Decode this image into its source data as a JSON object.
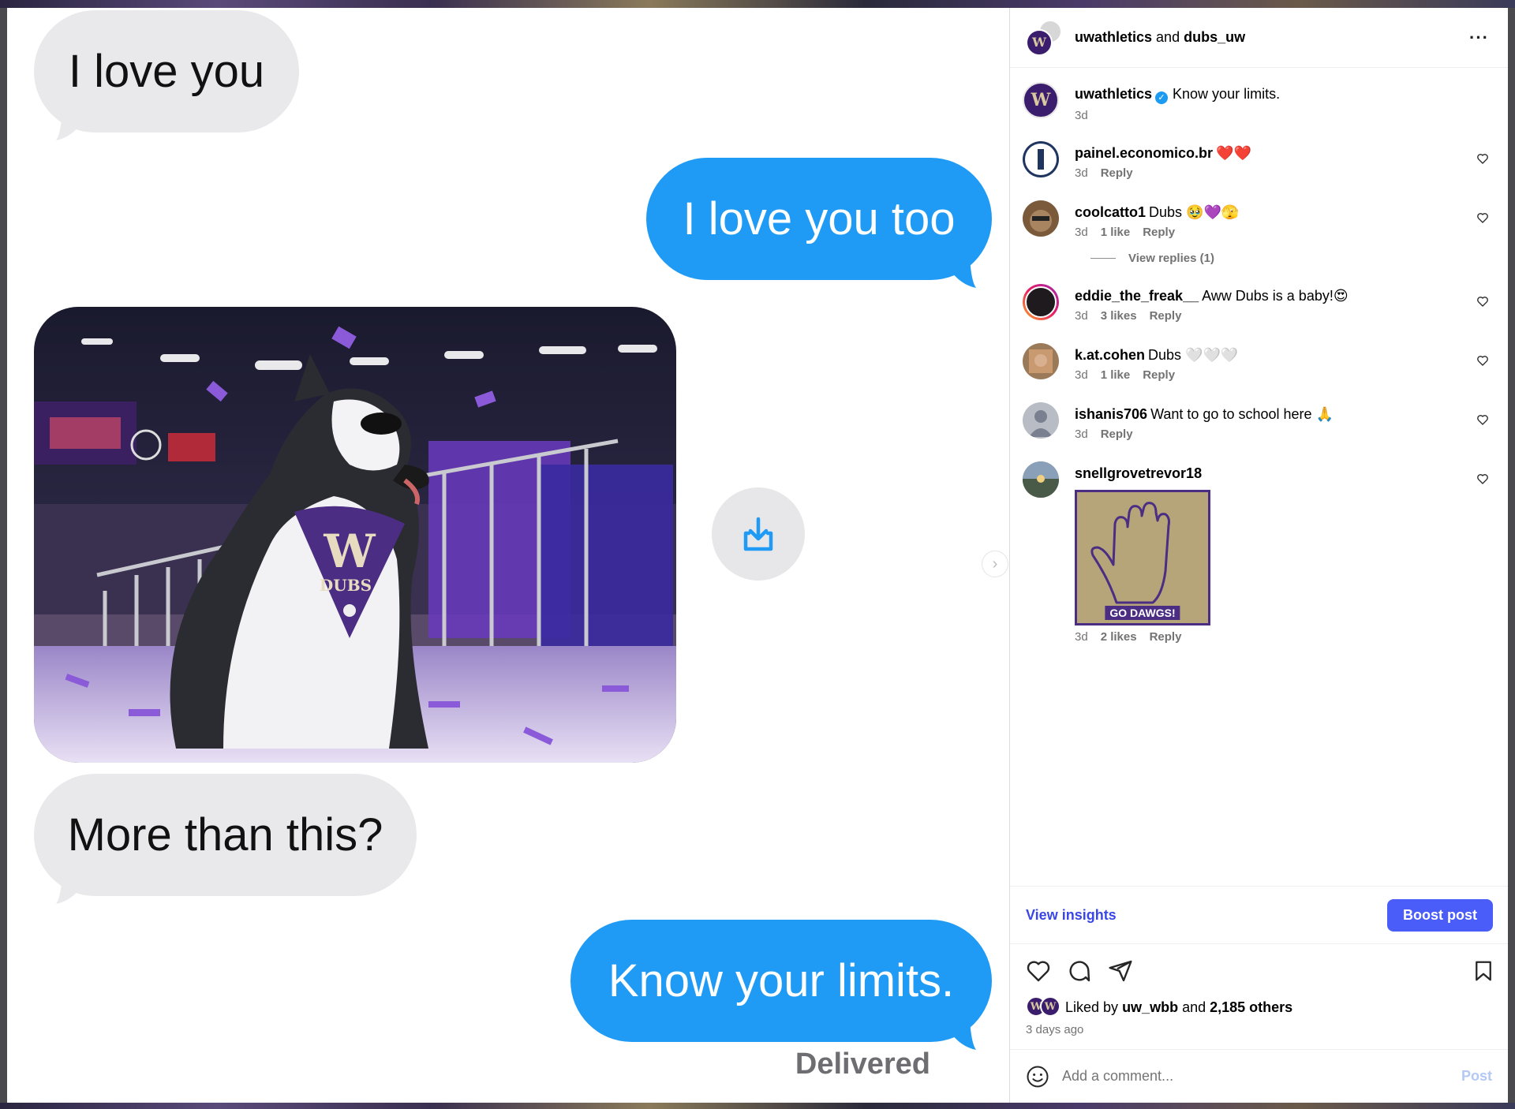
{
  "media": {
    "bubble_1": "I love you",
    "bubble_2": "I love you too",
    "bubble_3": "More than this?",
    "bubble_4": "Know your limits.",
    "status": "Delivered",
    "photo_bandana": "DUBS"
  },
  "header": {
    "user_a": "uwathletics",
    "joiner": "and",
    "user_b": "dubs_uw",
    "more_icon": "more-horizontal-icon"
  },
  "caption": {
    "user": "uwathletics",
    "text": "Know your limits.",
    "time": "3d"
  },
  "comments": [
    {
      "user": "painel.economico.br",
      "text": "❤️❤️",
      "time": "3d",
      "likes": "",
      "reply": "Reply",
      "avatar_color": "#2a3b5c"
    },
    {
      "user": "coolcatto1",
      "text": "Dubs 🥹💜🫣",
      "time": "3d",
      "likes": "1 like",
      "reply": "Reply",
      "avatar_color": "#7a5a3a"
    },
    {
      "user": "eddie_the_freak__",
      "text": "Aww Dubs is a baby!😍",
      "time": "3d",
      "likes": "3 likes",
      "reply": "Reply",
      "avatar_color": "#1e1a1e"
    },
    {
      "user": "k.at.cohen",
      "text": "Dubs 🤍🤍🤍",
      "time": "3d",
      "likes": "1 like",
      "reply": "Reply",
      "avatar_color": "#9b7a5a"
    },
    {
      "user": "ishanis706",
      "text": "Want to go to school here 🙏",
      "time": "3d",
      "likes": "",
      "reply": "Reply",
      "avatar_color": "#b8bcc4"
    },
    {
      "user": "snellgrovetrevor18",
      "text": "",
      "time": "3d",
      "likes": "2 likes",
      "reply": "Reply",
      "avatar_color": "#6b7a6a"
    }
  ],
  "view_replies": "View replies (1)",
  "sticker": {
    "label": "GO DAWGS!"
  },
  "insights": {
    "link": "View insights",
    "boost": "Boost post"
  },
  "likes": {
    "prefix": "Liked by",
    "user": "uw_wbb",
    "joiner": "and",
    "others": "2,185 others",
    "time": "3 days ago"
  },
  "add_comment": {
    "placeholder": "Add a comment...",
    "post": "Post"
  },
  "colors": {
    "bubble_blue": "#1f9bf5",
    "bubble_gray": "#e9e9eb",
    "link_blue": "#3a47e6",
    "boost_blue": "#4a5df9",
    "uw_purple": "#4b2e83"
  }
}
